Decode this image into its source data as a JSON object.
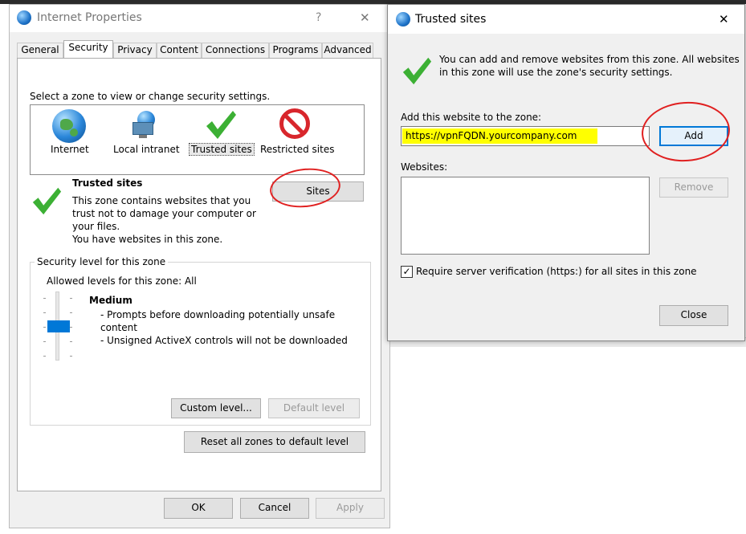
{
  "ip": {
    "title": "Internet Properties",
    "help": "?",
    "close": "✕",
    "tabs": [
      "General",
      "Security",
      "Privacy",
      "Content",
      "Connections",
      "Programs",
      "Advanced"
    ],
    "select_prompt": "Select a zone to view or change security settings.",
    "zones": [
      "Internet",
      "Local intranet",
      "Trusted sites",
      "Restricted sites"
    ],
    "zone_heading": "Trusted sites",
    "zone_desc_1": "This zone contains websites that you",
    "zone_desc_2": "trust not to damage your computer or",
    "zone_desc_3": "your files.",
    "zone_desc_4": "You have websites in this zone.",
    "sites_button": "Sites",
    "security_level_group": "Security level for this zone",
    "allowed_levels": "Allowed levels for this zone: All",
    "level_name": "Medium",
    "level_desc_1": "- Prompts before downloading potentially unsafe",
    "level_desc_2": "content",
    "level_desc_3": "- Unsigned ActiveX controls will not be downloaded",
    "custom_level": "Custom level...",
    "default_level": "Default level",
    "reset_all": "Reset all zones to default level",
    "ok": "OK",
    "cancel": "Cancel",
    "apply": "Apply"
  },
  "ts": {
    "title": "Trusted sites",
    "close": "✕",
    "info_1": "You can add and remove websites from this zone. All websites",
    "info_2": "in this zone will use the zone's security settings.",
    "add_label": "Add this website to the zone:",
    "add_value": "https://vpnFQDN.yourcompany.com",
    "add_button": "Add",
    "websites_label": "Websites:",
    "remove_button": "Remove",
    "require_https": "Require server verification (https:) for all sites in this zone",
    "require_checked": "✓",
    "close_button": "Close"
  },
  "colors": {
    "accent": "#0078d7",
    "highlight": "#ffff00",
    "annotation": "#e02020",
    "check": "#3cb034"
  }
}
